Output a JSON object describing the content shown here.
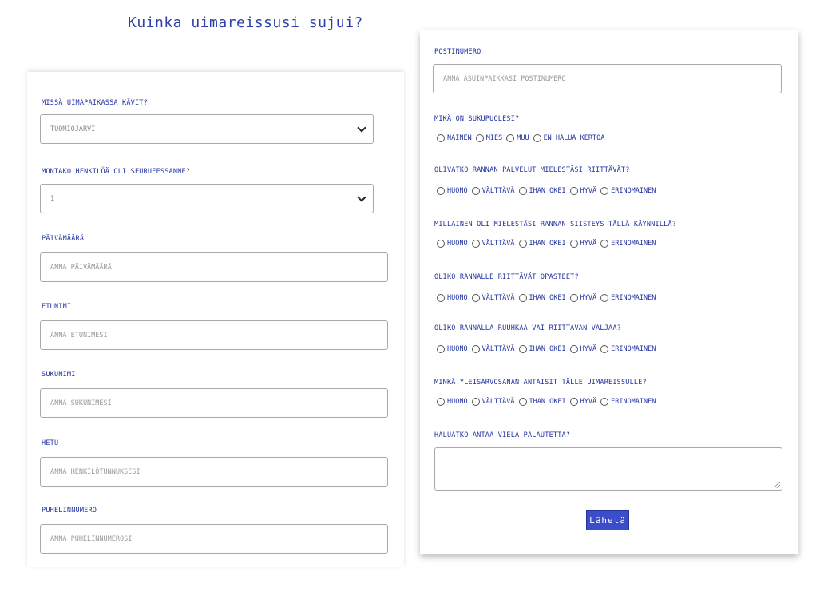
{
  "page": {
    "title": "Kuinka uimareissusi sujui?"
  },
  "left_form": {
    "place": {
      "label": "Missä uimapaikassa kävit?",
      "value": "Tuomiojärvi"
    },
    "group_size": {
      "label": "Montako henkilöä oli seurueessanne?",
      "value": "1"
    },
    "date": {
      "label": "Päivämäärä",
      "placeholder": "Anna päivämäärä"
    },
    "first_name": {
      "label": "Etunimi",
      "placeholder": "Anna etunimesi"
    },
    "last_name": {
      "label": "Sukunimi",
      "placeholder": "Anna sukunimesi"
    },
    "ssn": {
      "label": "Hetu",
      "placeholder": "Anna henkilötunnuksesi"
    },
    "phone": {
      "label": "Puhelinnumero",
      "placeholder": "Anna puhelinnumerosi"
    }
  },
  "right_form": {
    "postal": {
      "label": "Postinumero",
      "placeholder": "Anna asuinpaikkasi postinumero"
    },
    "gender": {
      "label": "Mikä on sukupuolesi?",
      "options": [
        "Nainen",
        "Mies",
        "Muu",
        "En halua kertoa"
      ]
    },
    "rating_options": [
      "Huono",
      "Välttävä",
      "Ihan okei",
      "Hyvä",
      "Erinomainen"
    ],
    "questions": [
      "Olivatko rannan palvelut mielestäsi riittävät?",
      "Millainen oli mielestäsi rannan siisteys tällä käynnillä?",
      "Oliko rannalle riittävät opasteet?",
      "Oliko rannalla ruuhkaa vai riittävän väljää?",
      "Minkä yleisarvosanan antaisit tälle uimareissulle?"
    ],
    "feedback": {
      "label": "Haluatko antaa vielä palautetta?"
    },
    "submit_label": "Lähetä"
  }
}
